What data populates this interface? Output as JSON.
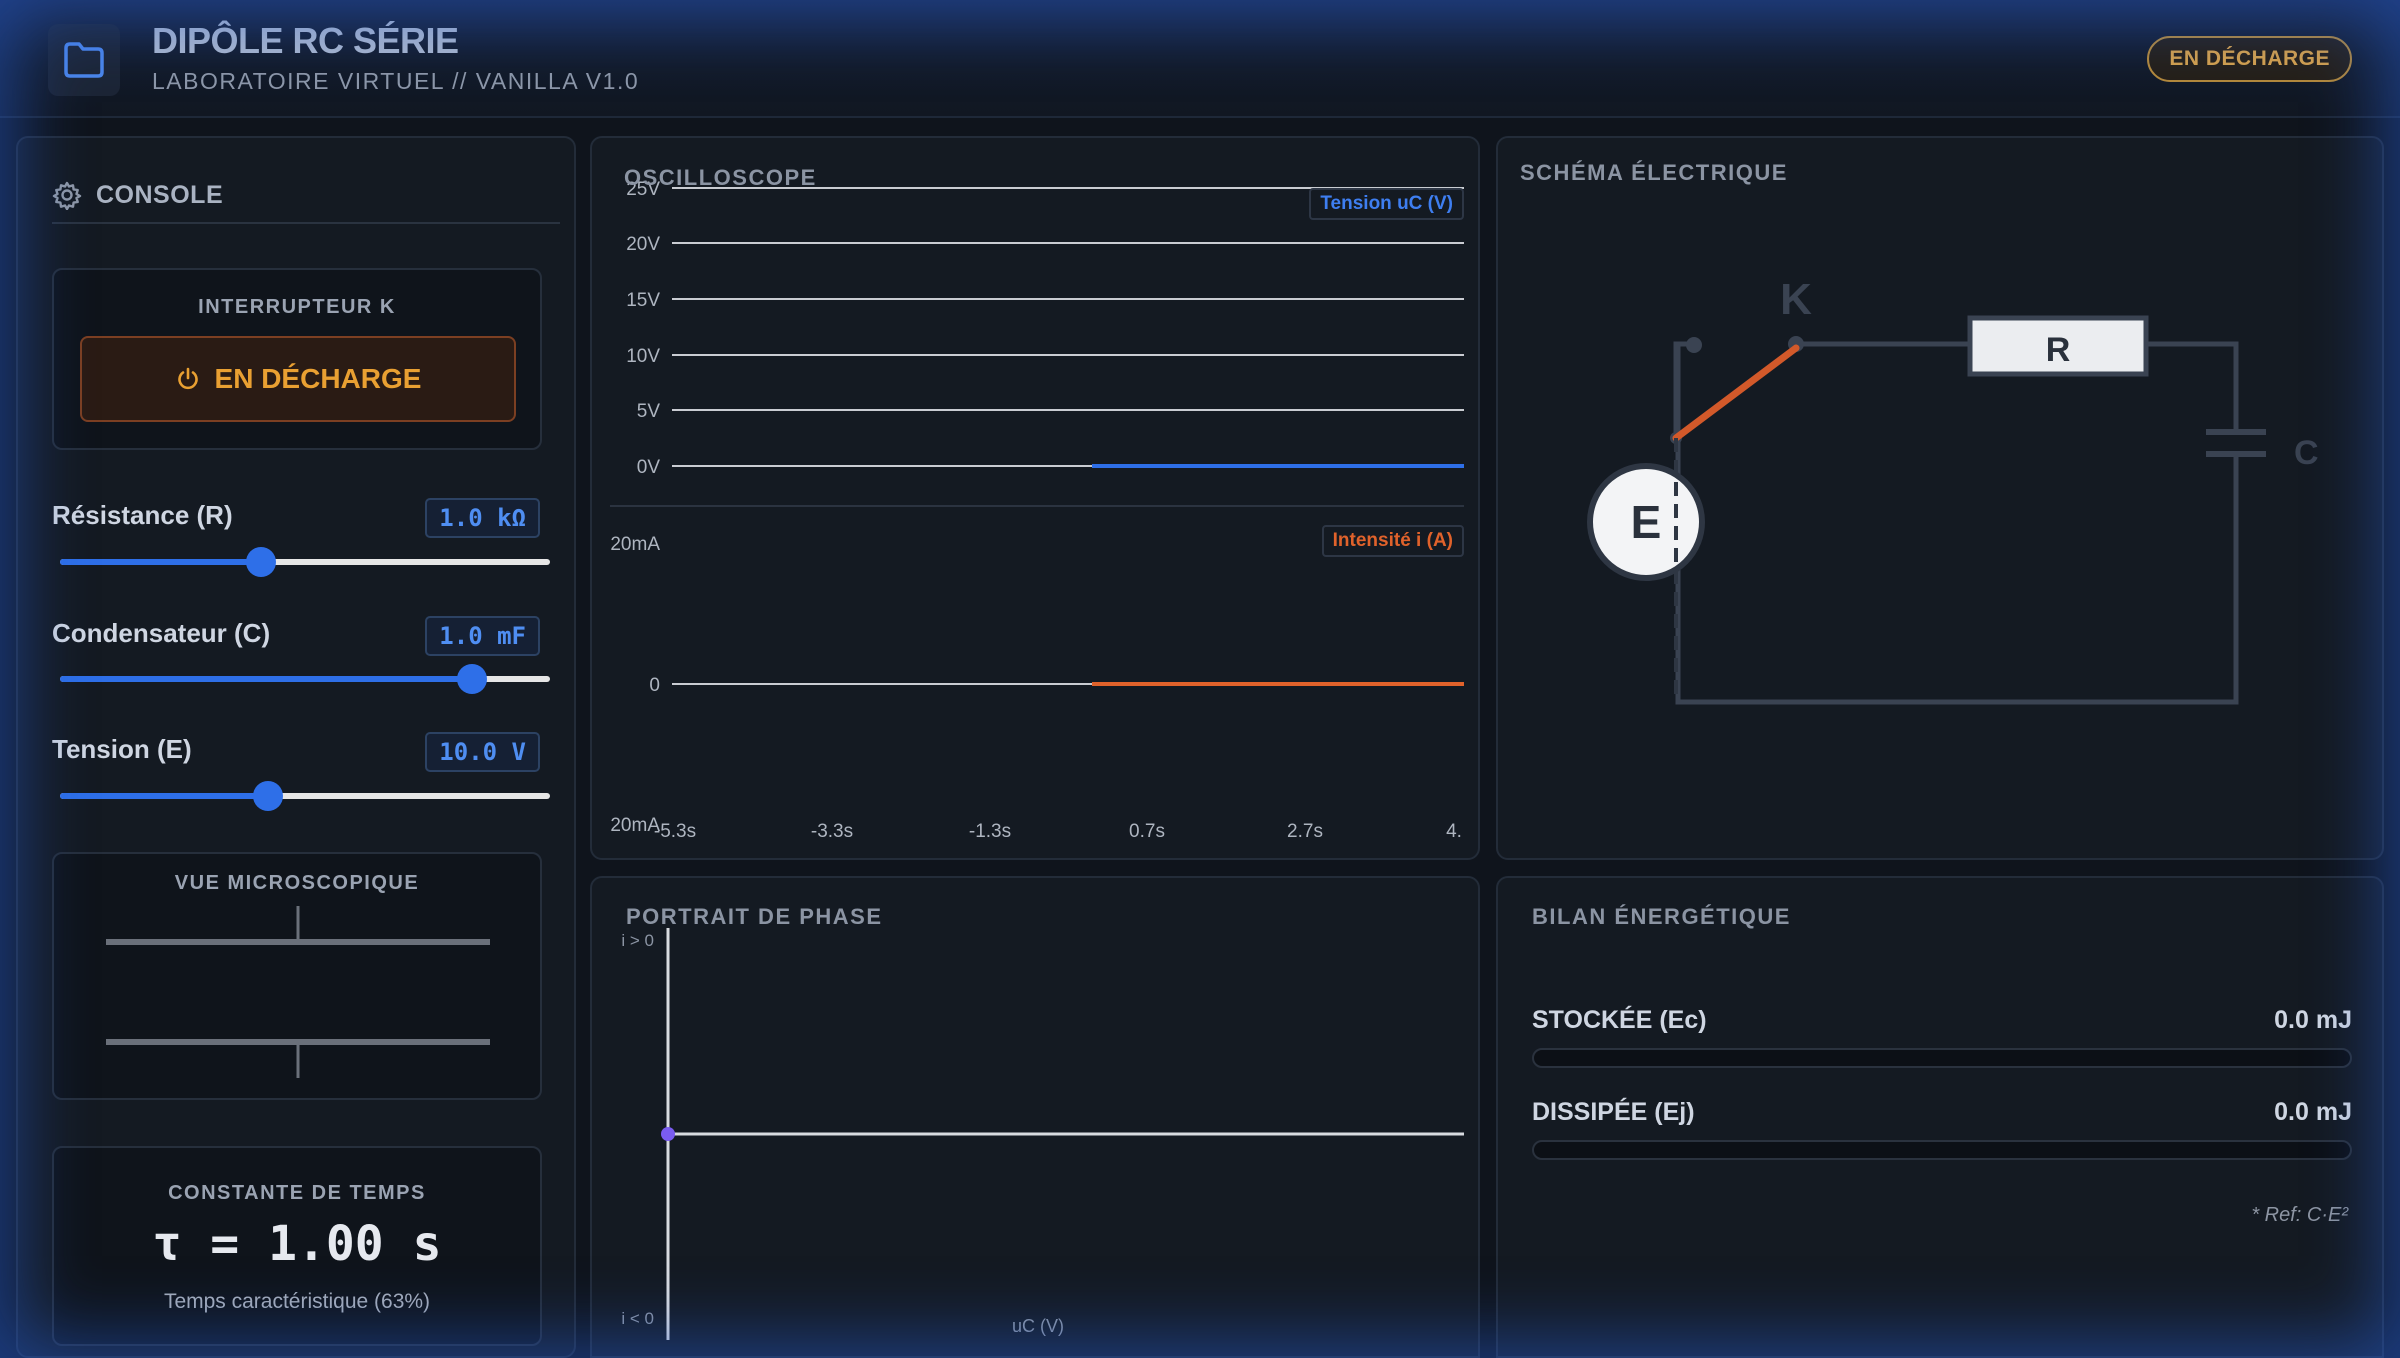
{
  "header": {
    "title": "DIPÔLE RC SÉRIE",
    "subtitle": "LABORATOIRE VIRTUEL // VANILLA V1.0",
    "state_badge": "EN DÉCHARGE"
  },
  "console": {
    "title": "CONSOLE",
    "switch": {
      "label": "INTERRUPTEUR K",
      "button": "EN DÉCHARGE"
    },
    "params": [
      {
        "label": "Résistance (R)",
        "value": "1.0 kΩ",
        "slider_fraction": 0.41
      },
      {
        "label": "Condensateur (C)",
        "value": "1.0 mF",
        "slider_fraction": 0.84
      },
      {
        "label": "Tension (E)",
        "value": "10.0 V",
        "slider_fraction": 0.425
      }
    ],
    "micro": {
      "label": "VUE MICROSCOPIQUE"
    },
    "time_constant": {
      "label": "CONSTANTE DE TEMPS",
      "value": "τ = 1.00 s",
      "note": "Temps caractéristique (63%)"
    }
  },
  "oscilloscope": {
    "title": "OSCILLOSCOPE",
    "voltage_legend": "Tension uC (V)",
    "current_legend": "Intensité i (A)",
    "voltage_ticks": [
      "25V",
      "20V",
      "15V",
      "10V",
      "5V",
      "0V"
    ],
    "current_ticks": [
      "20mA",
      "0",
      "20mA"
    ],
    "time_ticks": [
      "-5.3s",
      "-3.3s",
      "-1.3s",
      "0.7s",
      "2.7s",
      "4."
    ]
  },
  "schematic": {
    "title": "SCHÉMA ÉLECTRIQUE",
    "switch_label": "K",
    "resistor_label": "R",
    "capacitor_label": "C",
    "source_label": "E"
  },
  "phase": {
    "title": "PORTRAIT DE PHASE",
    "y_top": "i > 0",
    "y_bottom": "i < 0",
    "x_label": "uC (V)"
  },
  "energy": {
    "title": "BILAN ÉNERGÉTIQUE",
    "stored_label": "STOCKÉE (Ec)",
    "stored_value": "0.0 mJ",
    "stored_fraction": 0,
    "dissipated_label": "DISSIPÉE (Ej)",
    "dissipated_value": "0.0 mJ",
    "dissipated_fraction": 0,
    "ref": "* Ref: C·E²"
  },
  "colors": {
    "accent_blue": "#2e6fe8",
    "current_orange": "#e0622b",
    "switch_orange": "#d2592a",
    "badge_gold": "#d6a14b",
    "phase_point": "#7a5cf0"
  }
}
